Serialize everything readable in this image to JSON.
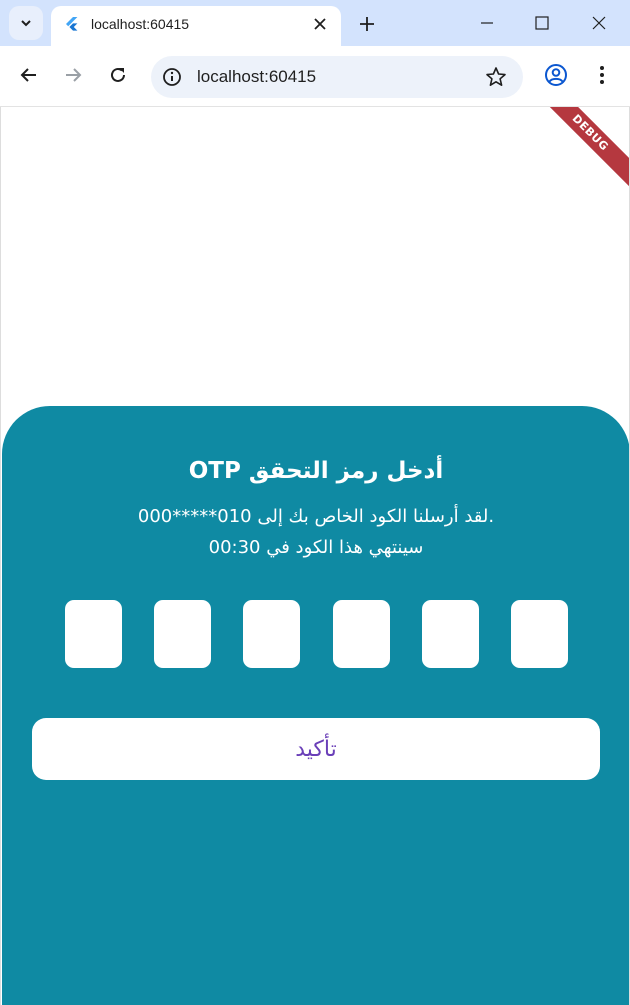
{
  "browser": {
    "tab_title": "localhost:60415",
    "url": "localhost:60415"
  },
  "app": {
    "debug_label": "DEBUG",
    "title": "أدخل رمز التحقق OTP",
    "message_line1": ".لقد أرسلنا الكود الخاص بك إلى 010*****000",
    "message_line2": "سينتهي هذا الكود في 00:30",
    "otp_digits": [
      "",
      "",
      "",
      "",
      "",
      ""
    ],
    "confirm_label": "تأكيد"
  },
  "colors": {
    "card": "#0f8aa3",
    "confirm_text": "#6a3fb8",
    "debug_banner": "#b5383f"
  }
}
